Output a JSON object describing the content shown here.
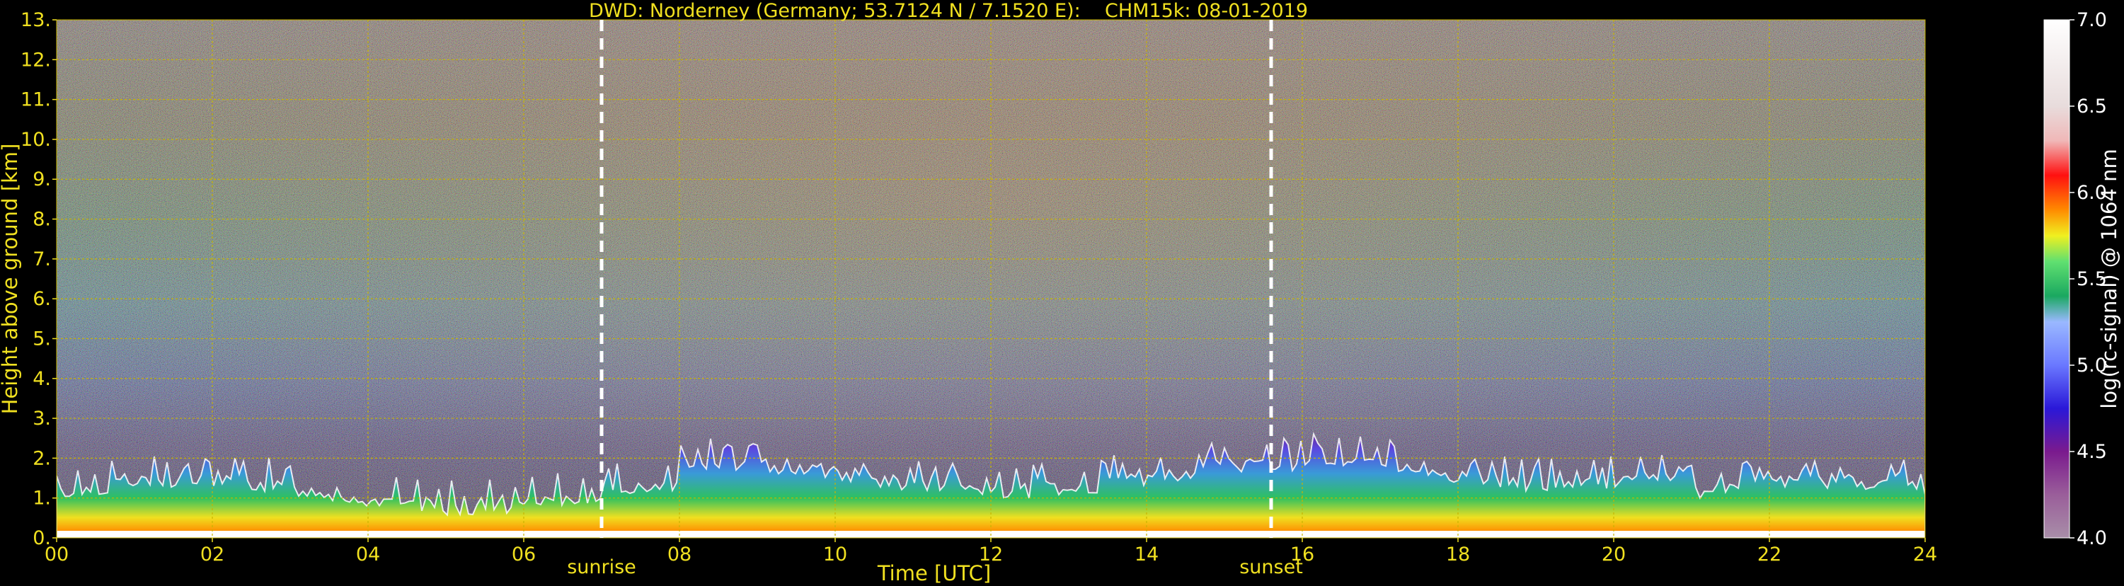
{
  "chart_data": {
    "type": "heatmap",
    "title": "DWD: Norderney (Germany; 53.7124 N / 7.1520 E):    CHM15k: 08-01-2019",
    "xlabel": "Time [UTC]",
    "ylabel": "Height above ground [km]",
    "xlim": [
      0,
      24
    ],
    "ylim": [
      0,
      13
    ],
    "x_ticks": [
      {
        "value": 0,
        "label": "00"
      },
      {
        "value": 2,
        "label": "02"
      },
      {
        "value": 4,
        "label": "04"
      },
      {
        "value": 6,
        "label": "06"
      },
      {
        "value": 8,
        "label": "08"
      },
      {
        "value": 10,
        "label": "10"
      },
      {
        "value": 12,
        "label": "12"
      },
      {
        "value": 14,
        "label": "14"
      },
      {
        "value": 16,
        "label": "16"
      },
      {
        "value": 18,
        "label": "18"
      },
      {
        "value": 20,
        "label": "20"
      },
      {
        "value": 22,
        "label": "22"
      },
      {
        "value": 24,
        "label": "24"
      }
    ],
    "y_ticks": [
      {
        "value": 0,
        "label": "0."
      },
      {
        "value": 1,
        "label": "1."
      },
      {
        "value": 2,
        "label": "2."
      },
      {
        "value": 3,
        "label": "3."
      },
      {
        "value": 4,
        "label": "4."
      },
      {
        "value": 5,
        "label": "5."
      },
      {
        "value": 6,
        "label": "6."
      },
      {
        "value": 7,
        "label": "7."
      },
      {
        "value": 8,
        "label": "8."
      },
      {
        "value": 9,
        "label": "9."
      },
      {
        "value": 10,
        "label": "10."
      },
      {
        "value": 11,
        "label": "11."
      },
      {
        "value": 12,
        "label": "12."
      },
      {
        "value": 13,
        "label": "13."
      }
    ],
    "grid": true,
    "annotations": [
      {
        "label": "sunrise",
        "x": 7.0
      },
      {
        "label": "sunset",
        "x": 15.6
      }
    ],
    "colorbar": {
      "label": "log(rc-signal) @ 1064 nm",
      "range": [
        4.0,
        7.0
      ],
      "ticks": [
        {
          "value": 4.0,
          "label": "4.0"
        },
        {
          "value": 4.5,
          "label": "4.5"
        },
        {
          "value": 5.0,
          "label": "5.0"
        },
        {
          "value": 5.5,
          "label": "5.5"
        },
        {
          "value": 6.0,
          "label": "6.0"
        },
        {
          "value": 6.5,
          "label": "6.5"
        },
        {
          "value": 7.0,
          "label": "7.0"
        }
      ],
      "stops": [
        {
          "value": 4.0,
          "color": "#a88ea8"
        },
        {
          "value": 4.25,
          "color": "#9a5e9a"
        },
        {
          "value": 4.5,
          "color": "#7a1a8e"
        },
        {
          "value": 4.75,
          "color": "#2a18d8"
        },
        {
          "value": 5.0,
          "color": "#6a78ff"
        },
        {
          "value": 5.25,
          "color": "#9ab8ff"
        },
        {
          "value": 5.4,
          "color": "#1aa860"
        },
        {
          "value": 5.6,
          "color": "#60e070"
        },
        {
          "value": 5.75,
          "color": "#f0f020"
        },
        {
          "value": 5.9,
          "color": "#ff8a00"
        },
        {
          "value": 6.1,
          "color": "#ff1010"
        },
        {
          "value": 6.3,
          "color": "#f0b8b8"
        },
        {
          "value": 6.5,
          "color": "#e8dcdc"
        },
        {
          "value": 7.0,
          "color": "#ffffff"
        }
      ]
    },
    "colors": {
      "background": "#000000",
      "axis_text": "#f0e020",
      "grid": "#c8b400",
      "marker_line": "#ffffff",
      "colorbar_text": "#ffffff"
    }
  }
}
